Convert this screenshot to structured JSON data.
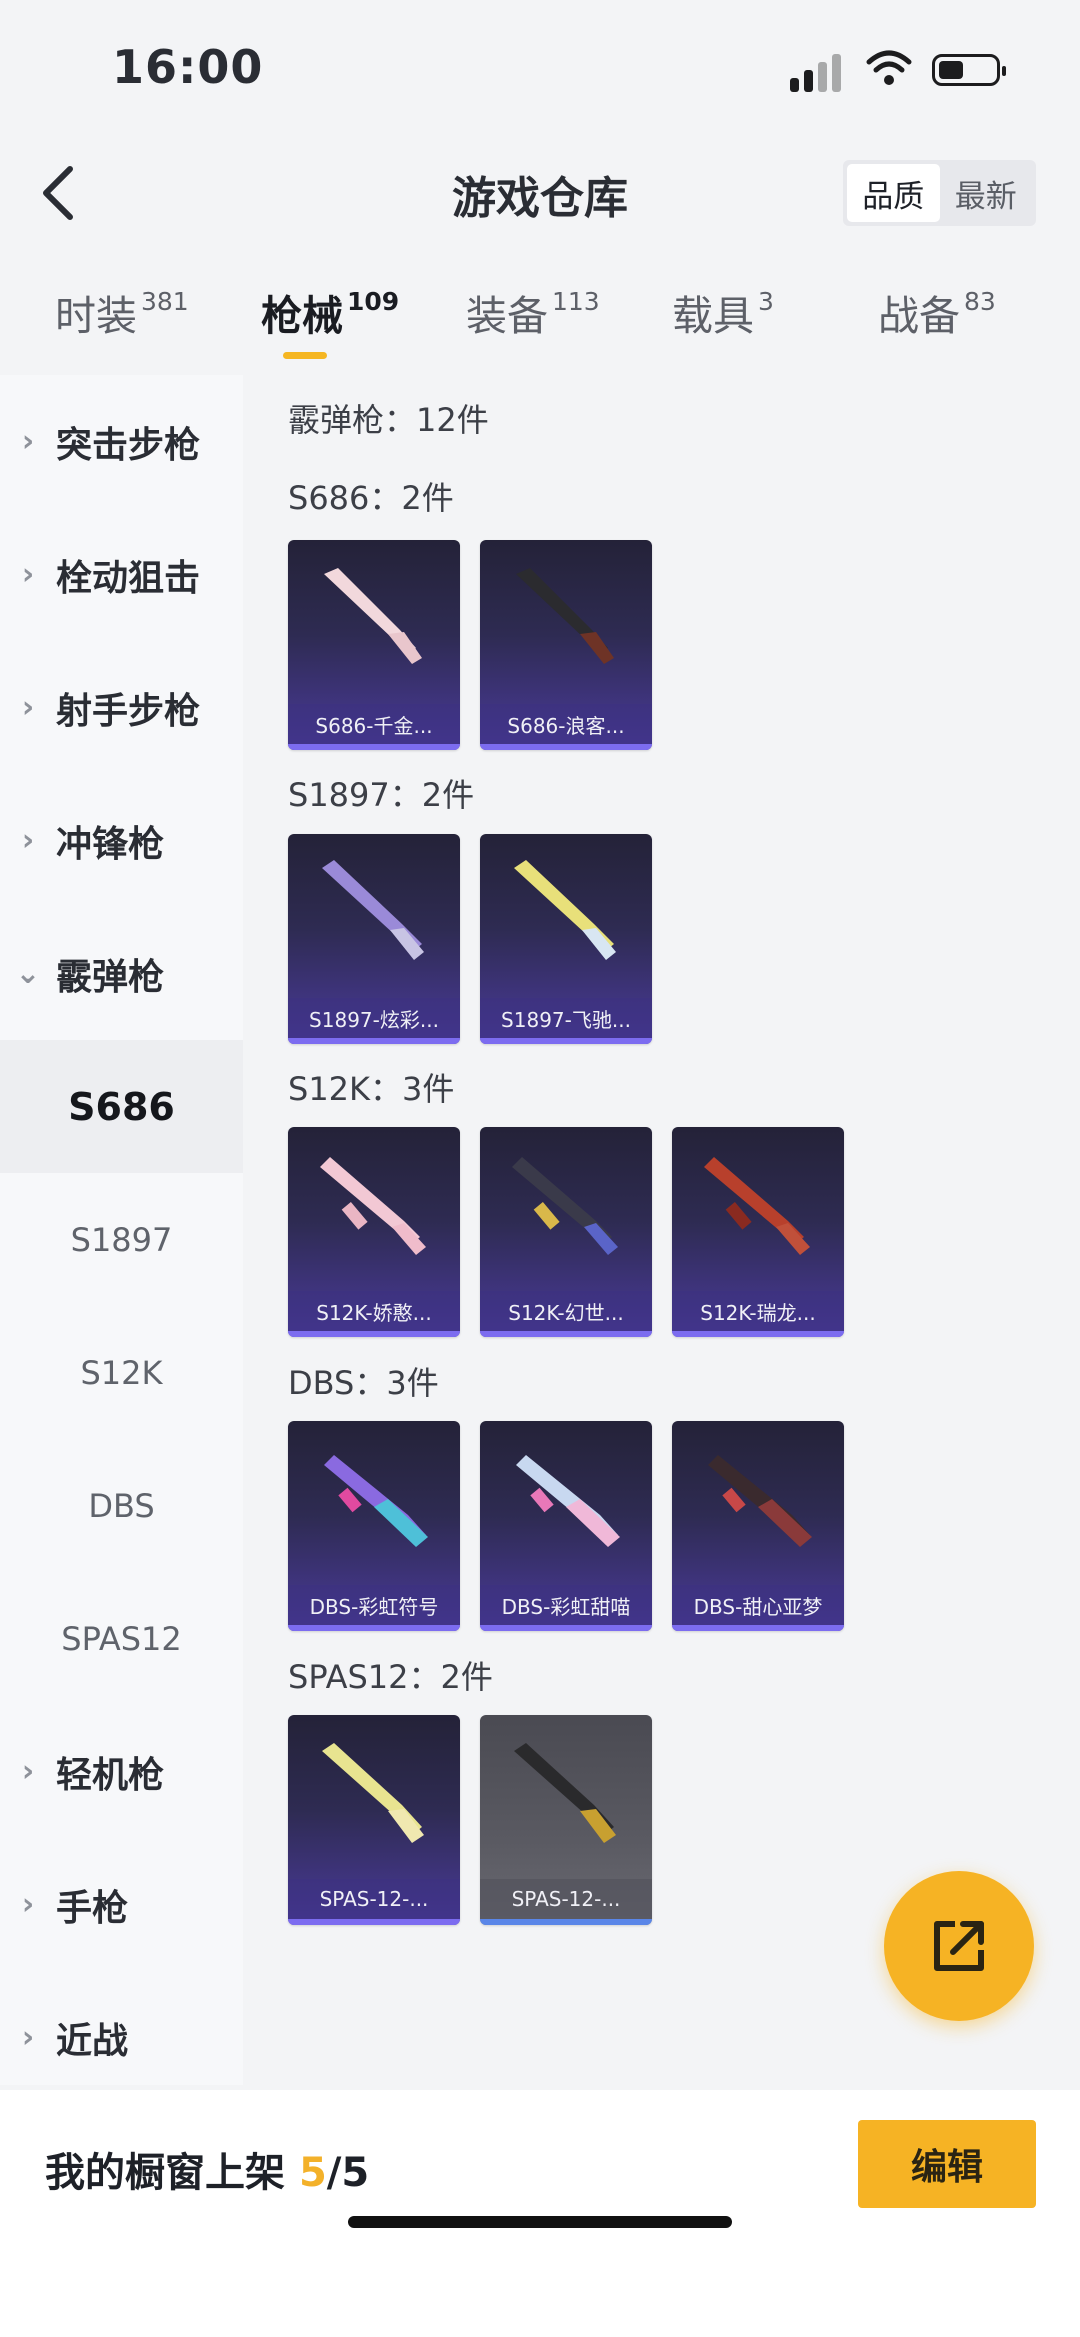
{
  "status_bar": {
    "time": "16:00"
  },
  "header": {
    "title": "游戏仓库",
    "sort_options": [
      "品质",
      "最新"
    ]
  },
  "tabs": [
    {
      "label": "时装",
      "count": "381"
    },
    {
      "label": "枪械",
      "count": "109"
    },
    {
      "label": "装备",
      "count": "113"
    },
    {
      "label": "载具",
      "count": "3"
    },
    {
      "label": "战备",
      "count": "83"
    }
  ],
  "sidebar": {
    "items": [
      {
        "label": "突击步枪"
      },
      {
        "label": "栓动狙击"
      },
      {
        "label": "射手步枪"
      },
      {
        "label": "冲锋枪"
      },
      {
        "label": "霰弹枪"
      }
    ],
    "sub_items": [
      "S686",
      "S1897",
      "S12K",
      "DBS",
      "SPAS12"
    ],
    "items_after": [
      {
        "label": "轻机枪"
      },
      {
        "label": "手枪"
      },
      {
        "label": "近战"
      }
    ]
  },
  "content": {
    "category_summary": "霰弹枪：12件",
    "groups": [
      {
        "label": "S686：2件",
        "items": [
          "S686-千金...",
          "S686-浪客..."
        ]
      },
      {
        "label": "S1897：2件",
        "items": [
          "S1897-炫彩...",
          "S1897-飞驰..."
        ]
      },
      {
        "label": "S12K：3件",
        "items": [
          "S12K-娇憨...",
          "S12K-幻世...",
          "S12K-瑞龙..."
        ]
      },
      {
        "label": "DBS：3件",
        "items": [
          "DBS-彩虹符号",
          "DBS-彩虹甜喵",
          "DBS-甜心亚梦"
        ]
      },
      {
        "label": "SPAS12：2件",
        "items": [
          "SPAS-12-...",
          "SPAS-12-..."
        ]
      }
    ]
  },
  "bottom": {
    "showcase_label": "我的橱窗上架",
    "showcase_current": "5",
    "showcase_total": "/5",
    "edit_label": "编辑"
  },
  "colors": {
    "accent": "#f6b324",
    "card_purple": "#4a3a9a",
    "card_grey": "#5a5a62"
  }
}
